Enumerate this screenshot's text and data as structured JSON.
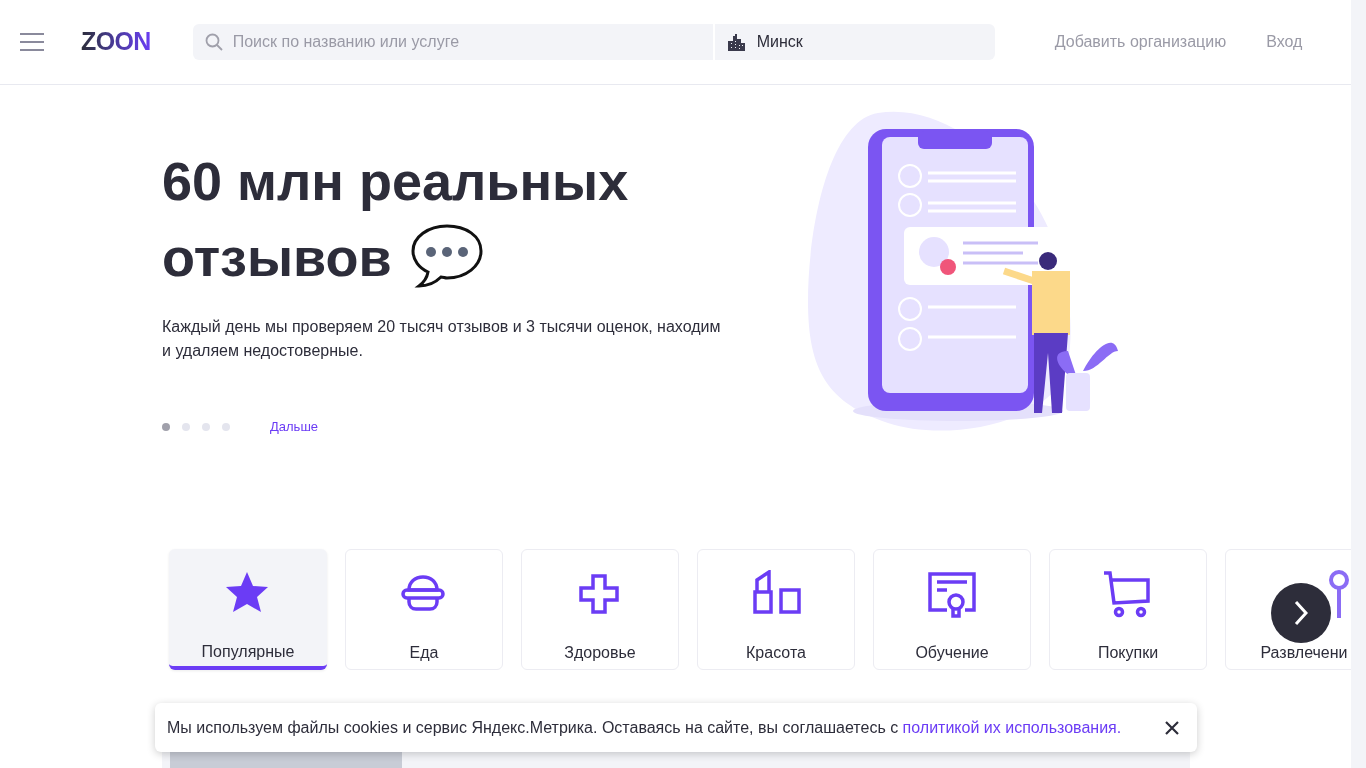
{
  "header": {
    "logo": "ZOON",
    "search": {
      "placeholder": "Поиск по названию или услуге"
    },
    "city": "Минск",
    "links": [
      "Добавить организацию",
      "Вход"
    ]
  },
  "hero": {
    "title_lines": [
      "60 млн реальных",
      "отзывов"
    ],
    "description": "Каждый день мы проверяем 20 тысяч отзывов и 3 тысячи оценок, находим и удаляем недостоверные.",
    "slides": [
      {
        "selected": true
      },
      {
        "selected": false
      },
      {
        "selected": false
      },
      {
        "selected": false
      }
    ],
    "next_label": "Дальше"
  },
  "categories": [
    {
      "kind": "star",
      "label": "Популярные",
      "selected": true
    },
    {
      "kind": "burger",
      "label": "Еда",
      "selected": false
    },
    {
      "kind": "cross",
      "label": "Здоровье",
      "selected": false
    },
    {
      "kind": "lipstick",
      "label": "Красота",
      "selected": false
    },
    {
      "kind": "certificate",
      "label": "Обучение",
      "selected": false
    },
    {
      "kind": "cart",
      "label": "Покупки",
      "selected": false
    },
    {
      "kind": "pin",
      "label": "Развлечени",
      "selected": false
    }
  ],
  "cookie": {
    "text": "Мы используем файлы cookies и сервис Яндекс.Метрика. Оставаясь на сайте, вы соглашаетесь с",
    "link": "политикой их использования."
  }
}
